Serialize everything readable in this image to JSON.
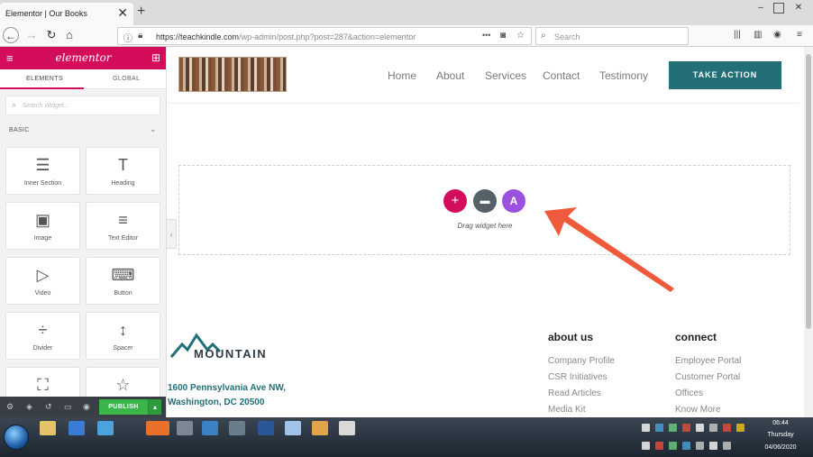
{
  "browser": {
    "tab_title": "Elementor | Our Books",
    "tab_close": "✕",
    "new_tab": "+",
    "url_host": "https://teachkindle.com",
    "url_path": "/wp-admin/post.php?post=287&action=elementor",
    "url_dots": "•••",
    "search_placeholder": "Search"
  },
  "panel": {
    "logo": "elementor",
    "tabs": [
      "ELEMENTS",
      "GLOBAL"
    ],
    "search_placeholder": "Search Widget...",
    "category": "BASIC",
    "widgets": [
      {
        "label": "Inner Section",
        "icon": "inner-section-icon",
        "glyph": "☰"
      },
      {
        "label": "Heading",
        "icon": "heading-icon",
        "glyph": "T"
      },
      {
        "label": "Image",
        "icon": "image-icon",
        "glyph": "▣"
      },
      {
        "label": "Text Editor",
        "icon": "text-editor-icon",
        "glyph": "≡"
      },
      {
        "label": "Video",
        "icon": "video-icon",
        "glyph": "▷"
      },
      {
        "label": "Button",
        "icon": "button-icon",
        "glyph": "⌨"
      },
      {
        "label": "Divider",
        "icon": "divider-icon",
        "glyph": "÷"
      },
      {
        "label": "Spacer",
        "icon": "spacer-icon",
        "glyph": "↕"
      },
      {
        "label": "",
        "icon": "google-maps-icon",
        "glyph": "⛶"
      },
      {
        "label": "",
        "icon": "icon-widget-icon",
        "glyph": "☆"
      }
    ],
    "publish_label": "PUBLISH",
    "accent_color": "#d30c5c"
  },
  "site": {
    "nav": [
      "Home",
      "About",
      "Services",
      "Contact",
      "Testimony"
    ],
    "cta_label": "TAKE ACTION",
    "cta_color": "#226f77",
    "drop_hint": "Drag widget here",
    "footer_logo_text": "MOUNTAIN",
    "address_line1": "1600 Pennsylvania Ave NW,",
    "address_line2": "Washington, DC 20500",
    "columns": [
      {
        "title": "about us",
        "links": [
          "Company Profile",
          "CSR Initiatives",
          "Read Articles",
          "Media Kit"
        ]
      },
      {
        "title": "connect",
        "links": [
          "Employee Portal",
          "Customer Portal",
          "Offices",
          "Know More"
        ]
      }
    ]
  },
  "taskbar": {
    "time": "06:44",
    "day": "Thursday",
    "date": "04/06/2020"
  }
}
